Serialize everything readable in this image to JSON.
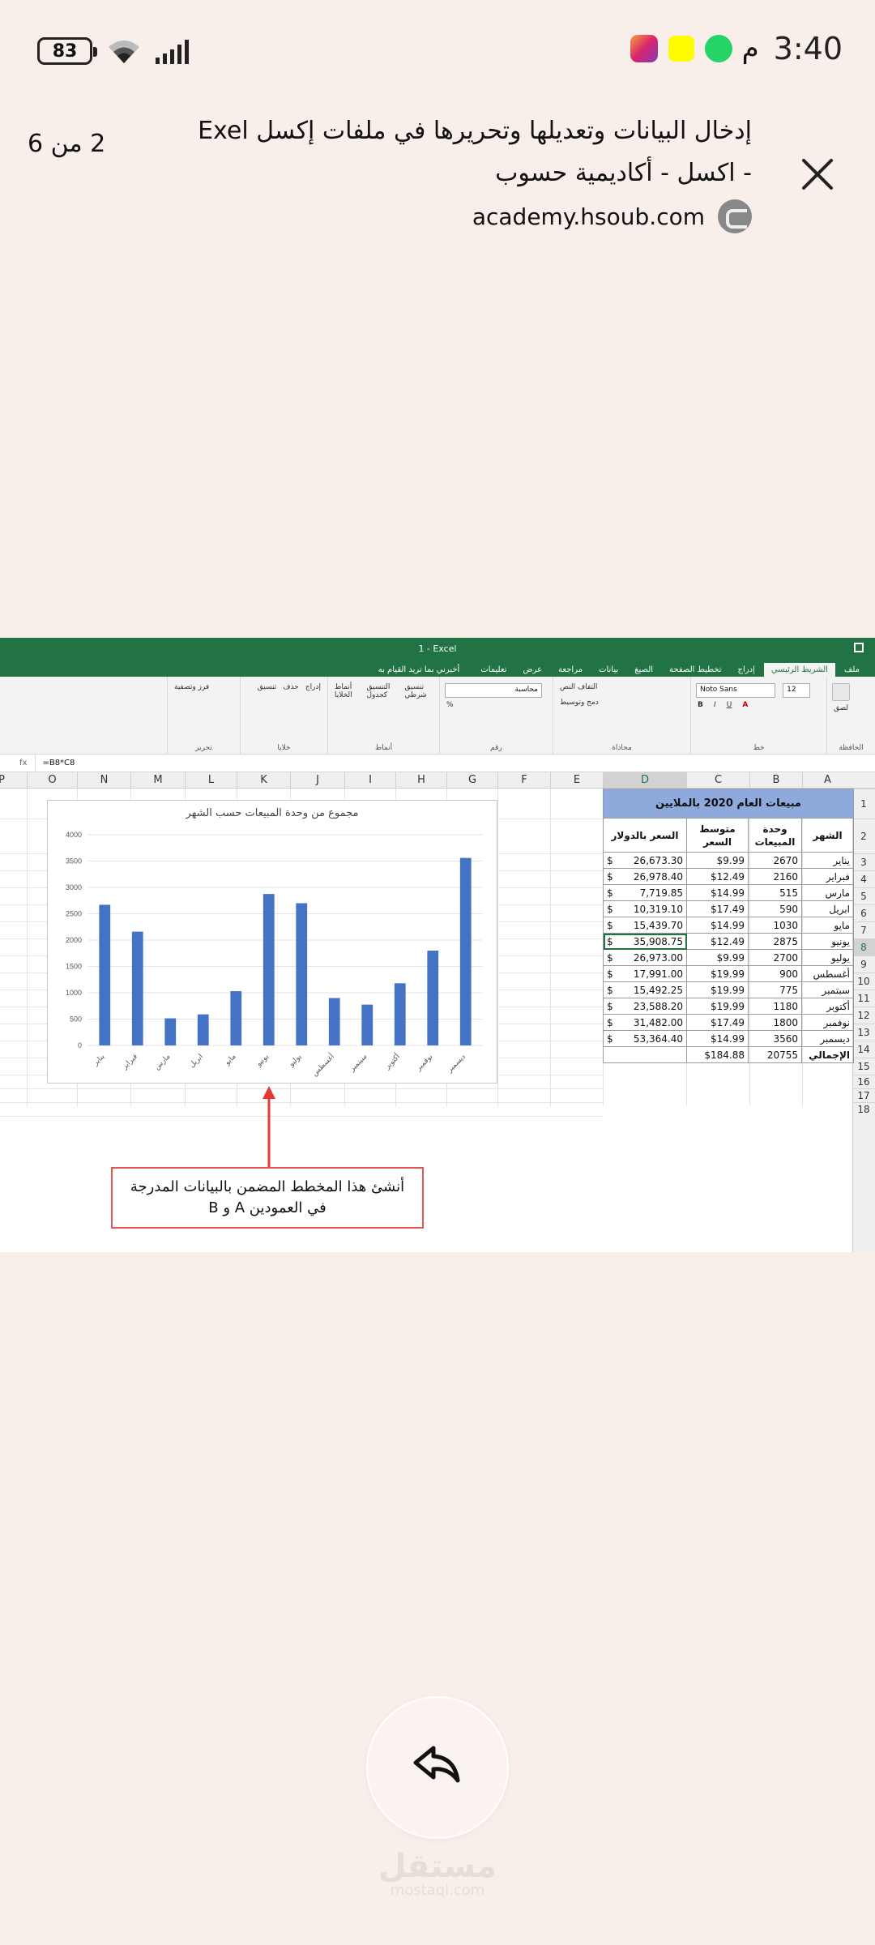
{
  "status_bar": {
    "time": "3:40",
    "time_suffix": "م",
    "battery": "83"
  },
  "header": {
    "page_counter": "2 من 6",
    "title": "إدخال البيانات وتعديلها وتحريرها في ملفات إكسل Exel - اكسل - أكاديمية حسوب",
    "domain": "academy.hsoub.com"
  },
  "excel": {
    "window_title": "1 - Excel",
    "tabs": [
      "ملف",
      "الشريط الرئيسي",
      "إدراج",
      "تخطيط الصفحة",
      "الصيغ",
      "بيانات",
      "مراجعة",
      "عرض",
      "تعليمات"
    ],
    "tell_me": "أخبرني بما تريد القيام به",
    "ribbon": {
      "font_name": "Noto Sans",
      "font_size": "12",
      "number_format": "محاسبة",
      "wrap_text": "التفاف النص",
      "merge_center": "دمج وتوسيط",
      "paste": "لصق",
      "conditional": "تنسيق شرطي",
      "format_table": "التنسيق كجدول",
      "cell_styles": "أنماط الخلايا",
      "insert": "إدراج",
      "delete": "حذف",
      "format": "تنسيق",
      "sort_filter": "فرز وتصفية",
      "groups": [
        "الحافظة",
        "خط",
        "محاذاة",
        "رقم",
        "أنماط",
        "خلايا",
        "تحرير"
      ]
    },
    "formula_bar": {
      "fx": "fx",
      "formula": "=B8*C8"
    },
    "columns": [
      "A",
      "B",
      "C",
      "D",
      "E",
      "F",
      "G",
      "H",
      "I",
      "J",
      "K",
      "L",
      "M",
      "N",
      "O",
      "P"
    ],
    "row_numbers": [
      "1",
      "2",
      "3",
      "4",
      "5",
      "6",
      "7",
      "8",
      "9",
      "10",
      "11",
      "12",
      "13",
      "14",
      "15",
      "16",
      "17",
      "18"
    ],
    "sheet": {
      "banner": "مبيعات العام 2020 بالملايين",
      "headers": [
        "الشهر",
        "وحدة المبيعات",
        "متوسط السعر",
        "السعر بالدولار"
      ],
      "currency": "$",
      "rows": [
        {
          "month": "يناير",
          "units": "2670",
          "price": "$9.99",
          "total": "26,673.30"
        },
        {
          "month": "فبراير",
          "units": "2160",
          "price": "$12.49",
          "total": "26,978.40"
        },
        {
          "month": "مارس",
          "units": "515",
          "price": "$14.99",
          "total": "7,719.85"
        },
        {
          "month": "ابريل",
          "units": "590",
          "price": "$17.49",
          "total": "10,319.10"
        },
        {
          "month": "مايو",
          "units": "1030",
          "price": "$14.99",
          "total": "15,439.70"
        },
        {
          "month": "يونيو",
          "units": "2875",
          "price": "$12.49",
          "total": "35,908.75"
        },
        {
          "month": "يوليو",
          "units": "2700",
          "price": "$9.99",
          "total": "26,973.00"
        },
        {
          "month": "أغسطس",
          "units": "900",
          "price": "$19.99",
          "total": "17,991.00"
        },
        {
          "month": "سبتمبر",
          "units": "775",
          "price": "$19.99",
          "total": "15,492.25"
        },
        {
          "month": "أكتوبر",
          "units": "1180",
          "price": "$19.99",
          "total": "23,588.20"
        },
        {
          "month": "نوفمبر",
          "units": "1800",
          "price": "$17.49",
          "total": "31,482.00"
        },
        {
          "month": "ديسمبر",
          "units": "3560",
          "price": "$14.99",
          "total": "53,364.40"
        }
      ],
      "total_label": "الإجمالي",
      "total_units": "20755",
      "total_price": "$184.88"
    }
  },
  "chart_data": {
    "type": "bar",
    "title": "مجموع من وحدة المبيعات حسب الشهر",
    "categories": [
      "يناير",
      "فبراير",
      "مارس",
      "ابريل",
      "مايو",
      "يونيو",
      "يوليو",
      "أغسطس",
      "سبتمبر",
      "أكتوبر",
      "نوفمبر",
      "ديسمبر"
    ],
    "values": [
      2670,
      2160,
      515,
      590,
      1030,
      2875,
      2700,
      900,
      775,
      1180,
      1800,
      3560
    ],
    "ylim": [
      0,
      4000
    ],
    "yticks": [
      0,
      500,
      1000,
      1500,
      2000,
      2500,
      3000,
      3500,
      4000
    ],
    "grid": true,
    "bar_color": "#4472c4"
  },
  "annotation": {
    "line1": "أنشئ هذا المخطط المضمن بالبيانات المدرجة",
    "line2": "في العمودين A و B"
  },
  "watermark": {
    "ar": "مستقل",
    "en": "mostaql.com"
  },
  "colors": {
    "excel_green": "#217346",
    "banner_blue": "#8ea9db",
    "annotation_red": "#e35656"
  }
}
